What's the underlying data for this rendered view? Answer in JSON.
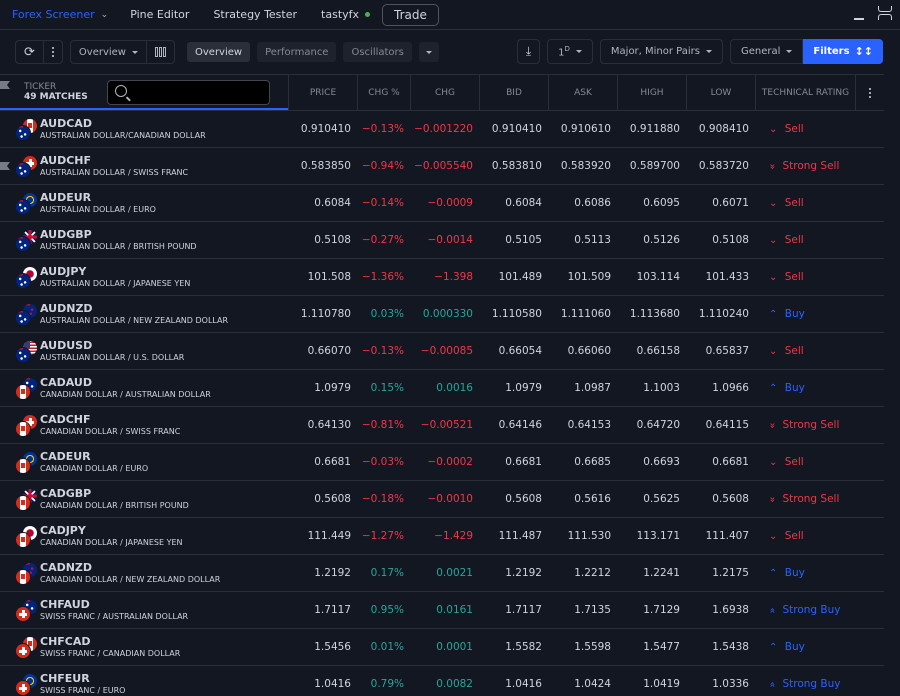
{
  "topbar": {
    "tabs": [
      {
        "label": "Forex Screener",
        "active": true
      },
      {
        "label": "Pine Editor"
      },
      {
        "label": "Strategy Tester"
      }
    ],
    "broker": "tastyfx",
    "trade_label": "Trade"
  },
  "toolbar": {
    "overview_select": "Overview",
    "pills": [
      "Overview",
      "Performance",
      "Oscillators"
    ],
    "interval": "1",
    "interval_sup": "D",
    "pairs_select": "Major, Minor Pairs",
    "general_select": "General",
    "filters_label": "Filters"
  },
  "table": {
    "ticker_header": "TICKER",
    "matches": "49 MATCHES",
    "search_placeholder": "",
    "columns": [
      "PRICE",
      "CHG %",
      "CHG",
      "BID",
      "ASK",
      "HIGH",
      "LOW",
      "TECHNICAL RATING"
    ],
    "rows": [
      {
        "symbol": "AUDCAD",
        "desc": "AUSTRALIAN DOLLAR/CANADIAN DOLLAR",
        "base": "AUD",
        "quote": "CAD",
        "price": "0.910410",
        "chgp": "−0.13%",
        "chg": "−0.001220",
        "bid": "0.910410",
        "ask": "0.910610",
        "high": "0.911880",
        "low": "0.908410",
        "rating": "Sell",
        "rating_icon": "chevron-down",
        "dir": "neg",
        "flagged": false
      },
      {
        "symbol": "AUDCHF",
        "desc": "AUSTRALIAN DOLLAR / SWISS FRANC",
        "base": "AUD",
        "quote": "CHF",
        "price": "0.583850",
        "chgp": "−0.94%",
        "chg": "−0.005540",
        "bid": "0.583810",
        "ask": "0.583920",
        "high": "0.589700",
        "low": "0.583720",
        "rating": "Strong Sell",
        "rating_icon": "double-chevron-down",
        "dir": "neg",
        "flagged": true
      },
      {
        "symbol": "AUDEUR",
        "desc": "AUSTRALIAN DOLLAR / EURO",
        "base": "AUD",
        "quote": "EUR",
        "price": "0.6084",
        "chgp": "−0.14%",
        "chg": "−0.0009",
        "bid": "0.6084",
        "ask": "0.6086",
        "high": "0.6095",
        "low": "0.6071",
        "rating": "Sell",
        "rating_icon": "chevron-down",
        "dir": "neg",
        "flagged": false
      },
      {
        "symbol": "AUDGBP",
        "desc": "AUSTRALIAN DOLLAR / BRITISH POUND",
        "base": "AUD",
        "quote": "GBP",
        "price": "0.5108",
        "chgp": "−0.27%",
        "chg": "−0.0014",
        "bid": "0.5105",
        "ask": "0.5113",
        "high": "0.5126",
        "low": "0.5108",
        "rating": "Sell",
        "rating_icon": "chevron-down",
        "dir": "neg",
        "flagged": false
      },
      {
        "symbol": "AUDJPY",
        "desc": "AUSTRALIAN DOLLAR / JAPANESE YEN",
        "base": "AUD",
        "quote": "JPY",
        "price": "101.508",
        "chgp": "−1.36%",
        "chg": "−1.398",
        "bid": "101.489",
        "ask": "101.509",
        "high": "103.114",
        "low": "101.433",
        "rating": "Sell",
        "rating_icon": "chevron-down",
        "dir": "neg",
        "flagged": false
      },
      {
        "symbol": "AUDNZD",
        "desc": "AUSTRALIAN DOLLAR / NEW ZEALAND DOLLAR",
        "base": "AUD",
        "quote": "NZD",
        "price": "1.110780",
        "chgp": "0.03%",
        "chg": "0.000330",
        "bid": "1.110580",
        "ask": "1.111060",
        "high": "1.113680",
        "low": "1.110240",
        "rating": "Buy",
        "rating_icon": "chevron-up",
        "dir": "pos",
        "flagged": false
      },
      {
        "symbol": "AUDUSD",
        "desc": "AUSTRALIAN DOLLAR / U.S. DOLLAR",
        "base": "AUD",
        "quote": "USD",
        "price": "0.66070",
        "chgp": "−0.13%",
        "chg": "−0.00085",
        "bid": "0.66054",
        "ask": "0.66060",
        "high": "0.66158",
        "low": "0.65837",
        "rating": "Sell",
        "rating_icon": "chevron-down",
        "dir": "neg",
        "flagged": false
      },
      {
        "symbol": "CADAUD",
        "desc": "CANADIAN DOLLAR / AUSTRALIAN DOLLAR",
        "base": "CAD",
        "quote": "AUD",
        "price": "1.0979",
        "chgp": "0.15%",
        "chg": "0.0016",
        "bid": "1.0979",
        "ask": "1.0987",
        "high": "1.1003",
        "low": "1.0966",
        "rating": "Buy",
        "rating_icon": "chevron-up",
        "dir": "pos",
        "flagged": false
      },
      {
        "symbol": "CADCHF",
        "desc": "CANADIAN DOLLAR / SWISS FRANC",
        "base": "CAD",
        "quote": "CHF",
        "price": "0.64130",
        "chgp": "−0.81%",
        "chg": "−0.00521",
        "bid": "0.64146",
        "ask": "0.64153",
        "high": "0.64720",
        "low": "0.64115",
        "rating": "Strong Sell",
        "rating_icon": "double-chevron-down",
        "dir": "neg",
        "flagged": false
      },
      {
        "symbol": "CADEUR",
        "desc": "CANADIAN DOLLAR / EURO",
        "base": "CAD",
        "quote": "EUR",
        "price": "0.6681",
        "chgp": "−0.03%",
        "chg": "−0.0002",
        "bid": "0.6681",
        "ask": "0.6685",
        "high": "0.6693",
        "low": "0.6681",
        "rating": "Sell",
        "rating_icon": "chevron-down",
        "dir": "neg",
        "flagged": false
      },
      {
        "symbol": "CADGBP",
        "desc": "CANADIAN DOLLAR / BRITISH POUND",
        "base": "CAD",
        "quote": "GBP",
        "price": "0.5608",
        "chgp": "−0.18%",
        "chg": "−0.0010",
        "bid": "0.5608",
        "ask": "0.5616",
        "high": "0.5625",
        "low": "0.5608",
        "rating": "Strong Sell",
        "rating_icon": "double-chevron-down",
        "dir": "neg",
        "flagged": false
      },
      {
        "symbol": "CADJPY",
        "desc": "CANADIAN DOLLAR / JAPANESE YEN",
        "base": "CAD",
        "quote": "JPY",
        "price": "111.449",
        "chgp": "−1.27%",
        "chg": "−1.429",
        "bid": "111.487",
        "ask": "111.530",
        "high": "113.171",
        "low": "111.407",
        "rating": "Sell",
        "rating_icon": "chevron-down",
        "dir": "neg",
        "flagged": false
      },
      {
        "symbol": "CADNZD",
        "desc": "CANADIAN DOLLAR / NEW ZEALAND DOLLAR",
        "base": "CAD",
        "quote": "NZD",
        "price": "1.2192",
        "chgp": "0.17%",
        "chg": "0.0021",
        "bid": "1.2192",
        "ask": "1.2212",
        "high": "1.2241",
        "low": "1.2175",
        "rating": "Buy",
        "rating_icon": "chevron-up",
        "dir": "pos",
        "flagged": false
      },
      {
        "symbol": "CHFAUD",
        "desc": "SWISS FRANC / AUSTRALIAN DOLLAR",
        "base": "CHF",
        "quote": "AUD",
        "price": "1.7117",
        "chgp": "0.95%",
        "chg": "0.0161",
        "bid": "1.7117",
        "ask": "1.7135",
        "high": "1.7129",
        "low": "1.6938",
        "rating": "Strong Buy",
        "rating_icon": "double-chevron-up",
        "dir": "pos",
        "flagged": false
      },
      {
        "symbol": "CHFCAD",
        "desc": "SWISS FRANC / CANADIAN DOLLAR",
        "base": "CHF",
        "quote": "CAD",
        "price": "1.5456",
        "chgp": "0.01%",
        "chg": "0.0001",
        "bid": "1.5582",
        "ask": "1.5598",
        "high": "1.5477",
        "low": "1.5438",
        "rating": "Buy",
        "rating_icon": "chevron-up",
        "dir": "pos",
        "flagged": false
      },
      {
        "symbol": "CHFEUR",
        "desc": "SWISS FRANC / EURO",
        "base": "CHF",
        "quote": "EUR",
        "price": "1.0416",
        "chgp": "0.79%",
        "chg": "0.0082",
        "bid": "1.0416",
        "ask": "1.0424",
        "high": "1.0419",
        "low": "1.0336",
        "rating": "Strong Buy",
        "rating_icon": "double-chevron-up",
        "dir": "pos",
        "flagged": false
      }
    ]
  },
  "colors": {
    "accent": "#2962ff",
    "positive": "#26a69a",
    "negative": "#f23645",
    "background": "#131722"
  }
}
